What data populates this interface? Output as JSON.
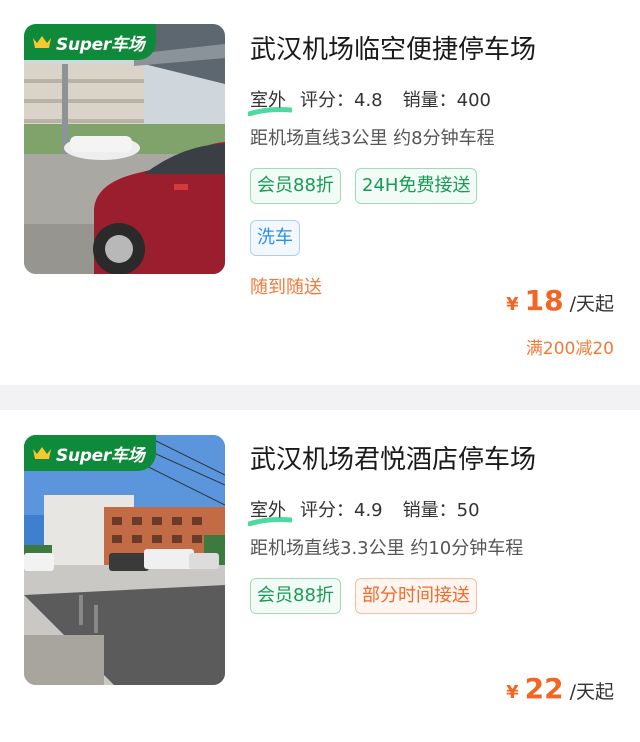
{
  "colors": {
    "brand_green": "#0f8a3a",
    "price_orange": "#f26522",
    "tag_green": "#179a56",
    "tag_blue": "#2a8ff0",
    "tag_orange": "#f26a2c"
  },
  "lots": [
    {
      "badge": "Super车场",
      "badge_icon": "crown-icon",
      "name": "武汉机场临空便捷停车场",
      "type": "室外",
      "rating_label": "评分：",
      "rating": "4.8",
      "sales_label": "销量：",
      "sales": "400",
      "distance": "距机场直线3公里 约8分钟车程",
      "tags": [
        "会员88折",
        "24H免费接送",
        "洗车"
      ],
      "service_note": "随到随送",
      "currency": "¥",
      "price": "18",
      "price_unit": "/天起",
      "discount": "满200减20"
    },
    {
      "badge": "Super车场",
      "badge_icon": "crown-icon",
      "name": "武汉机场君悦酒店停车场",
      "type": "室外",
      "rating_label": "评分：",
      "rating": "4.9",
      "sales_label": "销量：",
      "sales": "50",
      "distance": "距机场直线3.3公里 约10分钟车程",
      "tags": [
        "会员88折",
        "部分时间接送"
      ],
      "currency": "¥",
      "price": "22",
      "price_unit": "/天起"
    }
  ]
}
